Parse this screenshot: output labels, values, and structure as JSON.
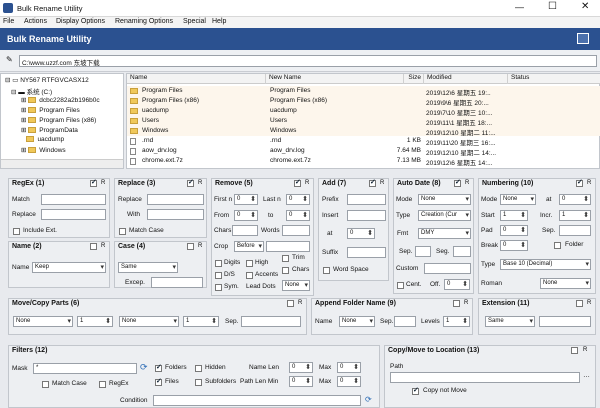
{
  "window": {
    "title": "Bulk Rename Utility",
    "controls": [
      "minimize",
      "maximize",
      "close"
    ]
  },
  "menu": [
    "File",
    "Actions",
    "Display Options",
    "Renaming Options",
    "Special",
    "Help"
  ],
  "banner": {
    "title": "Bulk Rename Utility"
  },
  "path": {
    "value": "C:\\www.uzzf.com  东坡下载"
  },
  "tree": [
    {
      "label": "NY567 RTFGVCASX12",
      "level": 0,
      "expander": "minus",
      "icon": "computer"
    },
    {
      "label": "系统 (C:)",
      "level": 1,
      "expander": "minus",
      "icon": "drive"
    },
    {
      "label": "dcbc2282a2b196b0c",
      "level": 2,
      "expander": "plus",
      "icon": "folder"
    },
    {
      "label": "Program Files",
      "level": 2,
      "expander": "plus",
      "icon": "folder"
    },
    {
      "label": "Program Files (x86)",
      "level": 2,
      "expander": "plus",
      "icon": "folder"
    },
    {
      "label": "ProgramData",
      "level": 2,
      "expander": "plus",
      "icon": "folder"
    },
    {
      "label": "uacdump",
      "level": 2,
      "expander": "",
      "icon": "folder"
    },
    {
      "label": "Windows",
      "level": 2,
      "expander": "plus",
      "icon": "folder"
    }
  ],
  "filelist": {
    "headers": {
      "name": "Name",
      "newname": "New Name",
      "size": "Size",
      "modified": "Modified",
      "status": "Status"
    },
    "rows": [
      {
        "name": "Program Files",
        "newname": "Program Files",
        "size": "",
        "modified": "2019\\12\\6 星期五 19:..",
        "icon": "folder"
      },
      {
        "name": "Program Files (x86)",
        "newname": "Program Files (x86)",
        "size": "",
        "modified": "2019\\9\\6 星期五 20:...",
        "icon": "folder"
      },
      {
        "name": "uacdump",
        "newname": "uacdump",
        "size": "",
        "modified": "2019\\7\\10 星期三 10:...",
        "icon": "folder"
      },
      {
        "name": "Users",
        "newname": "Users",
        "size": "",
        "modified": "2019\\11\\1 星期五 18:...",
        "icon": "folder"
      },
      {
        "name": "Windows",
        "newname": "Windows",
        "size": "",
        "modified": "2019\\12\\10 星期二 11:...",
        "icon": "folder"
      },
      {
        "name": ".rnd",
        "newname": ".rnd",
        "size": "1 KB",
        "modified": "2019\\11\\20 星期三 16:...",
        "icon": "file"
      },
      {
        "name": "aow_drv.log",
        "newname": "aow_drv.log",
        "size": "7.64 MB",
        "modified": "2019\\12\\10 星期二 14:...",
        "icon": "file"
      },
      {
        "name": "chrome.ext.7z",
        "newname": "chrome.ext.7z",
        "size": "7.13 MB",
        "modified": "2019\\12\\6 星期五 14:...",
        "icon": "file"
      }
    ]
  },
  "regex": {
    "title": "RegEx (1)",
    "match_label": "Match",
    "replace_label": "Replace",
    "include_ext": "Include Ext."
  },
  "replace": {
    "title": "Replace (3)",
    "replace_label": "Replace",
    "with_label": "With",
    "match_case": "Match Case"
  },
  "remove": {
    "title": "Remove (5)",
    "firstn": "First n",
    "firstn_val": "0",
    "lastn": "Last n",
    "lastn_val": "0",
    "from": "From",
    "from_val": "0",
    "to": "to",
    "to_val": "0",
    "chars": "Chars",
    "words": "Words",
    "crop": "Crop",
    "crop_val": "Before",
    "digits": "Digits",
    "high": "High",
    "trim": "Trim",
    "ds": "D/S",
    "accents": "Accents",
    "chars2": "Chars",
    "sym": "Sym.",
    "leaddots": "Lead Dots",
    "leaddots_val": "None"
  },
  "add": {
    "title": "Add (7)",
    "prefix": "Prefix",
    "insert": "Insert",
    "at": "at",
    "at_val": "0",
    "suffix": "Suffix",
    "wordspace": "Word Space"
  },
  "autodate": {
    "title": "Auto Date (8)",
    "mode": "Mode",
    "mode_val": "None",
    "type": "Type",
    "type_val": "Creation (Cur",
    "fmt": "Fmt",
    "fmt_val": "DMY",
    "sep": "Sep.",
    "seg": "Seg.",
    "custom": "Custom",
    "cent": "Cent.",
    "off": "Off.",
    "off_val": "0"
  },
  "numbering": {
    "title": "Numbering (10)",
    "mode": "Mode",
    "mode_val": "None",
    "at": "at",
    "at_val": "0",
    "start": "Start",
    "start_val": "1",
    "incr": "Incr.",
    "incr_val": "1",
    "pad": "Pad",
    "pad_val": "0",
    "sep": "Sep.",
    "break": "Break",
    "break_val": "0",
    "folder": "Folder",
    "type": "Type",
    "type_val": "Base 10 (Decimal)",
    "roman": "Roman",
    "roman_val": "None"
  },
  "name": {
    "title": "Name (2)",
    "label": "Name",
    "value": "Keep"
  },
  "case": {
    "title": "Case (4)",
    "value": "Same",
    "excep": "Excep."
  },
  "movecopy": {
    "title": "Move/Copy Parts (6)",
    "val1": "None",
    "num1": "1",
    "val2": "None",
    "num2": "1",
    "sep": "Sep."
  },
  "appendfolder": {
    "title": "Append Folder Name (9)",
    "name": "Name",
    "name_val": "None",
    "sep": "Sep.",
    "levels": "Levels",
    "levels_val": "1"
  },
  "extension": {
    "title": "Extension (11)",
    "value": "Same"
  },
  "filters": {
    "title": "Filters (12)",
    "mask": "Mask",
    "mask_val": "*",
    "folders": "Folders",
    "hidden": "Hidden",
    "files": "Files",
    "subfolders": "Subfolders",
    "namelen": "Name Len",
    "namelen_val": "0",
    "max1": "Max",
    "max1_val": "0",
    "pathlen": "Path Len Min",
    "pathlen_val": "0",
    "max2": "Max",
    "max2_val": "0",
    "matchcase": "Match Case",
    "regex": "RegEx",
    "condition": "Condition"
  },
  "copymove": {
    "title": "Copy/Move to Location (13)",
    "path": "Path",
    "copynotmove": "Copy not Move"
  },
  "panelctl": {
    "r": "R",
    "x": "X"
  }
}
